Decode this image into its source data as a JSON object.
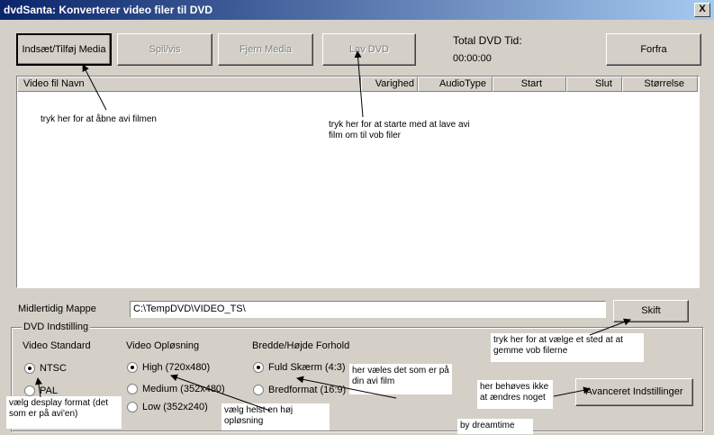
{
  "window": {
    "title": "dvdSanta: Konverterer video filer til DVD",
    "close": "X"
  },
  "toolbar": {
    "insert": "Indsæt/Tilføj Media",
    "play": "Spil/vis",
    "remove": "Fjern Media",
    "make_dvd": "Lav DVD",
    "total_label": "Total DVD Tid:",
    "total_value": "00:00:00",
    "about": "Forfra"
  },
  "table": {
    "columns": [
      "Video fil Navn",
      "Varighed",
      "AudioType",
      "Start",
      "Slut",
      "Størrelse"
    ]
  },
  "temp": {
    "label": "Midlertidig Mappe",
    "path": "C:\\TempDVD\\VIDEO_TS\\",
    "change": "Skift"
  },
  "settings": {
    "group": "DVD Indstilling",
    "standard_label": "Video Standard",
    "ntsc": "NTSC",
    "pal": "PAL",
    "resolution_label": "Video Opløsning",
    "high": "High (720x480)",
    "medium": "Medium (352x480)",
    "low": "Low (352x240)",
    "aspect_label": "Bredde/Højde Forhold",
    "full": "Fuld Skærm (4:3)",
    "wide": "Bredformat (16:9)",
    "advanced": "Avanceret Indstillinger"
  },
  "annotations": {
    "open_avi": "tryk her for at åbne avi filmen",
    "start_avi": "tryk her for at starte med at lave avi film om til vob filer",
    "choose_place": "tryk her for at vælge et sted at at gemme vob filerne",
    "display_format": "vælg desplay format (det som er på avi'en)",
    "high_res": "vælg helst en høj opløsning",
    "choose_here": "her væles det som er på din avi film",
    "no_change": "her behøves ikke at ændres noget",
    "credit": "by dreamtime"
  }
}
